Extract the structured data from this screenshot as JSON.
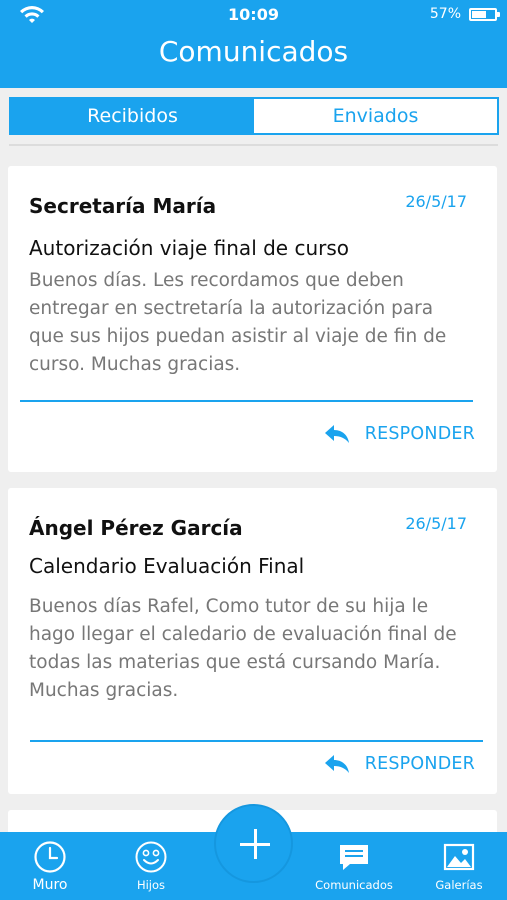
{
  "status_bar": {
    "time": "10:09",
    "battery": "57%",
    "battery_level": 0.57
  },
  "header": {
    "title": "Comunicados"
  },
  "tabs": [
    {
      "label": "Recibidos",
      "active": true
    },
    {
      "label": "Enviados",
      "active": false
    }
  ],
  "messages": [
    {
      "sender": "Secretaría María",
      "date": "26/5/17",
      "subject": "Autorización viaje final de curso",
      "body": "Buenos días. Les recordamos que deben entregar en sectretaría la autorización para que sus hijos puedan asistir al viaje de fin de curso. Muchas gracias.",
      "reply_label": "RESPONDER"
    },
    {
      "sender": "Ángel Pérez García",
      "date": "26/5/17",
      "subject": "Calendario Evaluación Final",
      "body": "Buenos días Rafel, Como tutor de su hija le hago llegar el caledario de evaluación final de todas las materias que está cursando María. Muchas gracias.",
      "reply_label": "RESPONDER"
    }
  ],
  "tabbar": {
    "items": [
      {
        "label": "Muro",
        "icon": "clock-icon"
      },
      {
        "label": "Hijos",
        "icon": "smiley-icon"
      },
      {
        "label": "Comunicados",
        "icon": "chat-icon"
      },
      {
        "label": "Galerías",
        "icon": "gallery-icon"
      }
    ],
    "fab_icon": "plus-icon"
  },
  "colors": {
    "accent": "#1aa3ee",
    "background": "#efefef",
    "body_text": "#777777"
  }
}
